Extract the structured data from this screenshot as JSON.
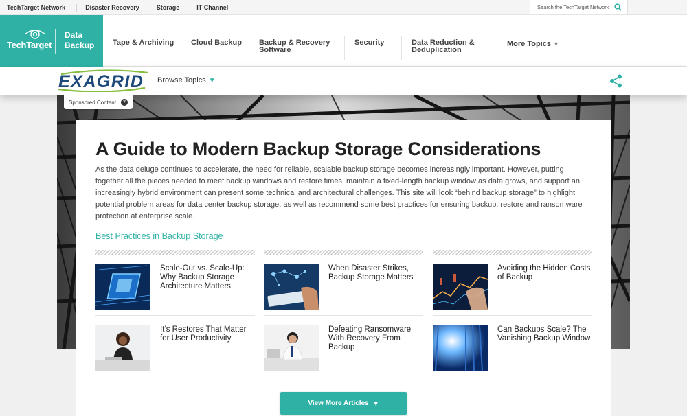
{
  "network_bar": {
    "links": [
      "TechTarget Network",
      "Disaster Recovery",
      "Storage",
      "IT Channel"
    ],
    "search_placeholder": "Search the TechTarget Network"
  },
  "brand": {
    "logo_text": "TechTarget",
    "section_line1": "Data",
    "section_line2": "Backup",
    "color": "#2fb2a5"
  },
  "nav": [
    {
      "line1": "Tape & Archiving",
      "line2": ""
    },
    {
      "line1": "Cloud Backup",
      "line2": ""
    },
    {
      "line1": "Backup & Recovery",
      "line2": "Software"
    },
    {
      "line1": "Security",
      "line2": ""
    },
    {
      "line1": "Data Reduction &",
      "line2": "Deduplication"
    },
    {
      "line1": "More Topics",
      "line2": ""
    }
  ],
  "sponsor": {
    "logo_text": "EXAGRID",
    "browse_label": "Browse Topics",
    "badge": "Sponsored Content"
  },
  "main": {
    "title": "A Guide to Modern Backup Storage Considerations",
    "intro": "As the data deluge continues to accelerate, the need for reliable, scalable backup storage becomes increasingly important. However, putting together all the pieces needed to meet backup windows and restore times, maintain a fixed-length backup window as data grows, and support an increasingly hybrid environment can present some technical and architectural challenges. This site will look “behind backup storage” to highlight potential problem areas for data center backup storage, as well as recommend some best practices for ensuring backup, restore and ransomware protection at enterprise scale.",
    "section_title": "Best Practices in Backup Storage",
    "articles": [
      {
        "title": "Scale-Out vs. Scale-Up: Why Backup Storage Architecture Matters",
        "thumb": "circuit-chip-image"
      },
      {
        "title": "When Disaster Strikes, Backup Storage Matters",
        "thumb": "tablet-network-image"
      },
      {
        "title": "Avoiding the Hidden Costs of Backup",
        "thumb": "finance-chart-image"
      },
      {
        "title": "It’s Restores That Matter for User Productivity",
        "thumb": "woman-laptop-image"
      },
      {
        "title": "Defeating Ransomware With Recovery From Backup",
        "thumb": "man-desk-image"
      },
      {
        "title": "Can Backups Scale? The Vanishing Backup Window",
        "thumb": "datacenter-light-image"
      }
    ],
    "more_button": "View More Articles"
  }
}
